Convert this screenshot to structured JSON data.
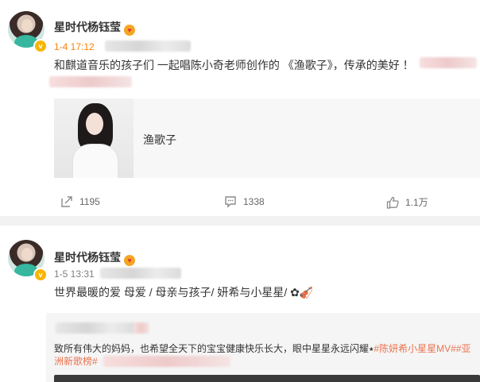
{
  "posts": [
    {
      "username": "星时代杨钰莹",
      "badge_text": "v",
      "time": "1-4 17:12",
      "content": "和麒道音乐的孩子们 一起唱陈小奇老师创作的 《渔歌子》，传承的美好 ！",
      "card": {
        "title": "渔歌子"
      },
      "actions": {
        "repost": "1195",
        "comment": "1338",
        "like": "1.1万"
      }
    },
    {
      "username": "星时代杨钰莹",
      "badge_text": "v",
      "time": "1-5 13:31",
      "content": "世界最暖的爱 母爱 / 母亲与孩子/ 妍希与小星星/ ✿🎻",
      "repost": {
        "text": "致所有伟大的妈妈，也希望全天下的宝宝健康快乐长大，眼中星星永远闪耀⭑",
        "tag1": "#陈妍希小星星MV##亚",
        "tag2": "洲新歌榜#"
      }
    }
  ],
  "colors": {
    "accent": "#ff8200",
    "link": "#eb7350",
    "badge": "#f7b500"
  },
  "icons": [
    "repost-icon",
    "comment-icon",
    "like-icon",
    "crown-icon",
    "verified-icon"
  ]
}
